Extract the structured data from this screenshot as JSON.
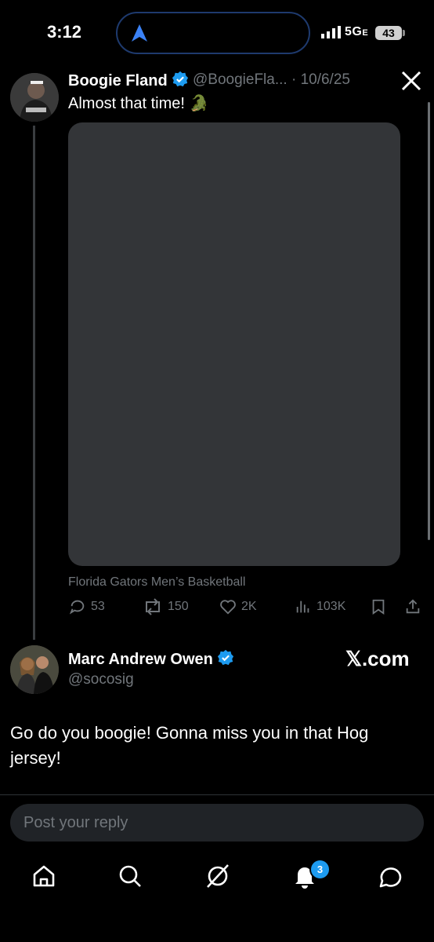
{
  "status_bar": {
    "time": "3:12",
    "network": "5G",
    "network_suffix": "E",
    "battery": "43"
  },
  "original_post": {
    "display_name": "Boogie Fland",
    "meta": "@BoogieFla... · 10/6/25",
    "text": "Almost that time! 🐊",
    "media_caption": "Florida Gators Men’s Basketball",
    "replies": "53",
    "reposts": "150",
    "likes": "2K",
    "views": "103K"
  },
  "reply_post": {
    "display_name": "Marc Andrew Owen",
    "handle": "@socosig",
    "source_label": "𝕏.com",
    "text": "Go do you boogie! Gonna miss you in that Hog jersey!"
  },
  "composer": {
    "placeholder": "Post your reply"
  },
  "bottom_nav": {
    "notification_count": "3"
  },
  "colors": {
    "accent": "#1d9bf0",
    "background": "#000000",
    "muted": "#71767b"
  },
  "icons": [
    "navigation-arrow-icon",
    "close-x-icon",
    "reply-icon",
    "repost-icon",
    "like-icon",
    "views-icon",
    "bookmark-icon",
    "share-icon",
    "home-icon",
    "search-icon",
    "grok-icon",
    "bell-icon",
    "messages-icon",
    "verified-icon"
  ]
}
